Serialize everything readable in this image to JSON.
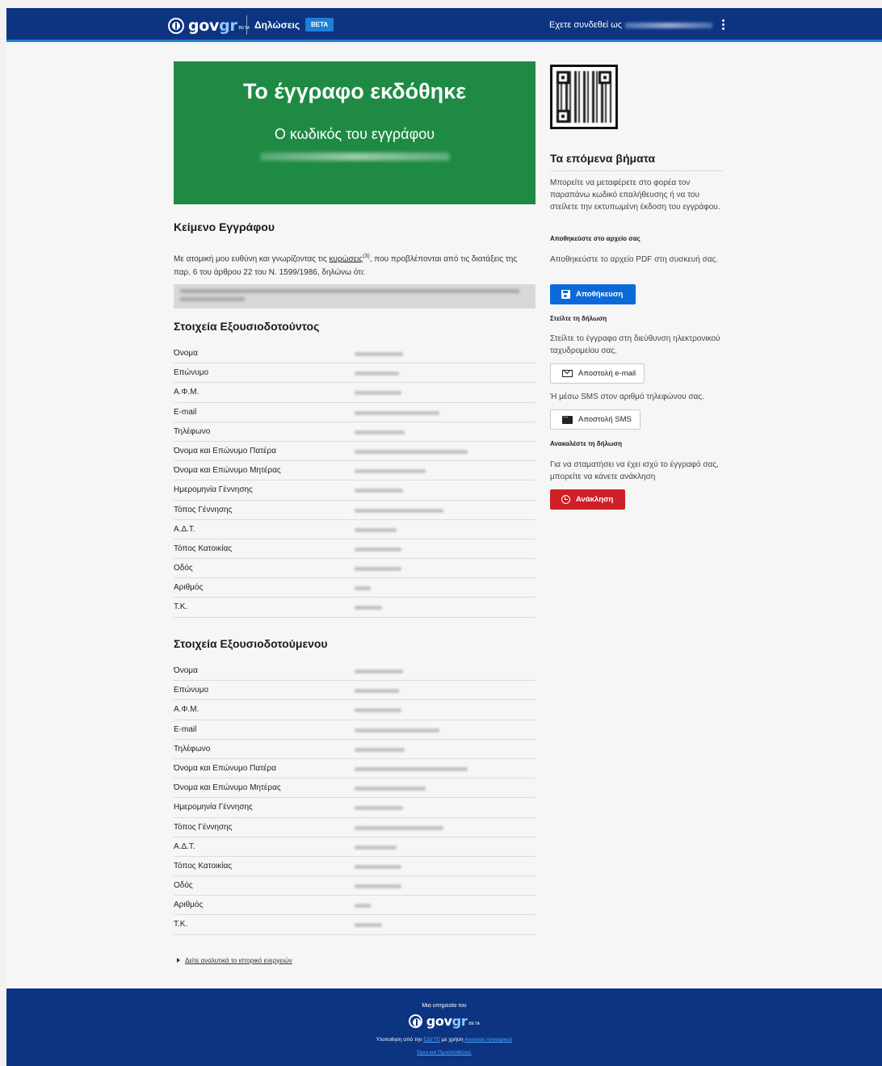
{
  "header": {
    "logo_main": "gov",
    "logo_accent": "gr",
    "logo_beta": "BETA",
    "app_title": "Δηλώσεις",
    "beta_badge": "BETA",
    "logged_in_label": "Εχετε συνδεθεί ως"
  },
  "banner": {
    "title": "Το έγγραφο εκδόθηκε",
    "code_label": "Ο κωδικός του εγγράφου"
  },
  "document": {
    "section_title": "Κείμενο Εγγράφου",
    "text_before": "Με ατομική μου ευθύνη και γνωρίζοντας τις ",
    "text_link": "κυρώσεις",
    "text_sup": "(3)",
    "text_after": ", που προβλέπονται από τις διατάξεις της παρ. 6 του άρθρου 22 του Ν. 1599/1986, δηλώνω ότι:"
  },
  "grantor": {
    "title": "Στοιχεία Εξουσιοδοτούντος",
    "labels": [
      "Όνομα",
      "Επώνυμο",
      "Α.Φ.Μ.",
      "E-mail",
      "Τηλέφωνο",
      "Όνομα και Επώνυμο Πατέρα",
      "Όνομα και Επώνυμο Μητέρας",
      "Ημερομηνία Γέννησης",
      "Τόπος Γέννησης",
      "Α.Δ.Τ.",
      "Τόπος Κατοικίας",
      "Οδός",
      "Αριθμός",
      "Τ.Κ."
    ]
  },
  "grantee": {
    "title": "Στοιχεία Εξουσιοδοτούμενου",
    "labels": [
      "Όνομα",
      "Επώνυμο",
      "Α.Φ.Μ.",
      "E-mail",
      "Τηλέφωνο",
      "Όνομα και Επώνυμο Πατέρα",
      "Όνομα και Επώνυμο Μητέρας",
      "Ημερομηνία Γέννησης",
      "Τόπος Γέννησης",
      "Α.Δ.Τ.",
      "Τόπος Κατοικίας",
      "Οδός",
      "Αριθμός",
      "Τ.Κ."
    ]
  },
  "history_link": "Δείτε αναλυτικά το ιστορικό ενεργειών",
  "next_steps": {
    "title": "Τα επόμενα βήματα",
    "intro": "Μπορείτε να μεταφέρετε στο φορέα τον παραπάνω κωδικό επαλήθευσης ή να του στείλετε την εκτυπωμένη έκδοση του εγγράφου.",
    "save_heading": "Αποθηκεύστε στο αρχείο σας",
    "save_text": "Αποθηκεύστε το αρχείο PDF στη συσκευή σας.",
    "save_button": "Αποθήκευση",
    "send_heading": "Στείλτε τη δήλωση",
    "send_text": "Στείλτε το έγγραφο στη διεύθυνση ηλεκτρονικού ταχυδρομείου σας.",
    "email_button": "Αποστολή e-mail",
    "sms_text": "Ή μέσω SMS στον αριθμό τηλεφώνου σας.",
    "sms_button": "Αποστολή SMS",
    "revoke_heading": "Ανακαλέστε τη δήλωση",
    "revoke_text": "Για να σταματήσει να έχει ισχύ το έγγραφό σας, μπορείτε να κάνετε ανάκληση",
    "revoke_button": "Ανάκληση"
  },
  "footer": {
    "service": "Μια υπηρεσία του",
    "impl_before": "Υλοποίηση από την ",
    "impl_org": "ΕΔΥΤΕ",
    "impl_mid": " με χρήση ",
    "impl_software": "Ανοικτού Λογισμικού",
    "terms": "Όροι και Προϋποθέσεις"
  },
  "colors": {
    "header_bg": "#0c3481",
    "banner_bg": "#1e8a44",
    "primary_button": "#0c6ad8",
    "danger_button": "#cf2027"
  }
}
